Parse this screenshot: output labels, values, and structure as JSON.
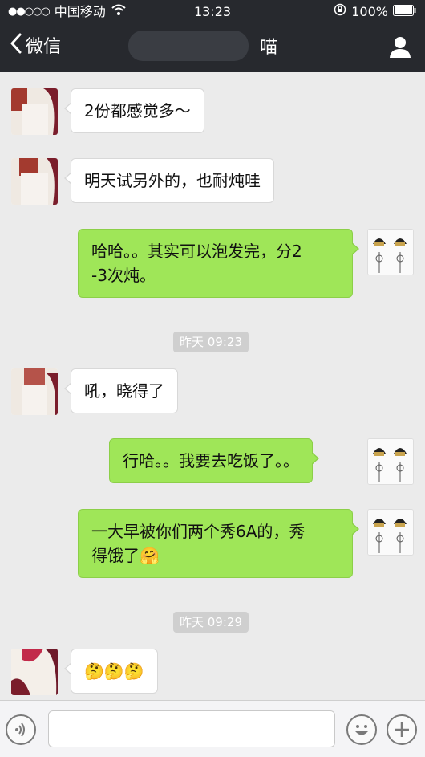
{
  "status_bar": {
    "signal_dots": "●●○○○",
    "carrier": "中国移动",
    "wifi_icon": "wifi-icon",
    "time": "13:23",
    "lock_icon": "rotation-lock-icon",
    "battery_percent": "100%",
    "battery_icon": "battery-icon"
  },
  "nav": {
    "back_label": "微信",
    "title": "喵"
  },
  "timestamps": [
    "昨天 09:23",
    "昨天 09:29"
  ],
  "messages": [
    {
      "side": "left",
      "text": "2份都感觉多～"
    },
    {
      "side": "left",
      "text": "明天试另外的，也耐炖哇"
    },
    {
      "side": "right",
      "line1": "哈哈。。其实可以泡发完，分2",
      "line2": "-3次炖。"
    },
    {
      "side": "left",
      "text": "吼，晓得了"
    },
    {
      "side": "right",
      "text": "行哈。。我要去吃饭了。。"
    },
    {
      "side": "right",
      "line1": "一大早被你们两个秀6A的，秀",
      "line2": "得饿了",
      "emoji": "🤗"
    },
    {
      "side": "left",
      "emoji": "🤔🤔🤔"
    }
  ],
  "colors": {
    "header_bg": "#27292e",
    "chat_bg": "#ebebeb",
    "bubble_in": "#ffffff",
    "bubble_out": "#9fe658",
    "timestamp_bg": "#cfcfcf"
  },
  "input_bar": {
    "voice_icon": "voice-icon",
    "emoji_icon": "emoji-icon",
    "plus_icon": "plus-icon",
    "text_value": ""
  }
}
